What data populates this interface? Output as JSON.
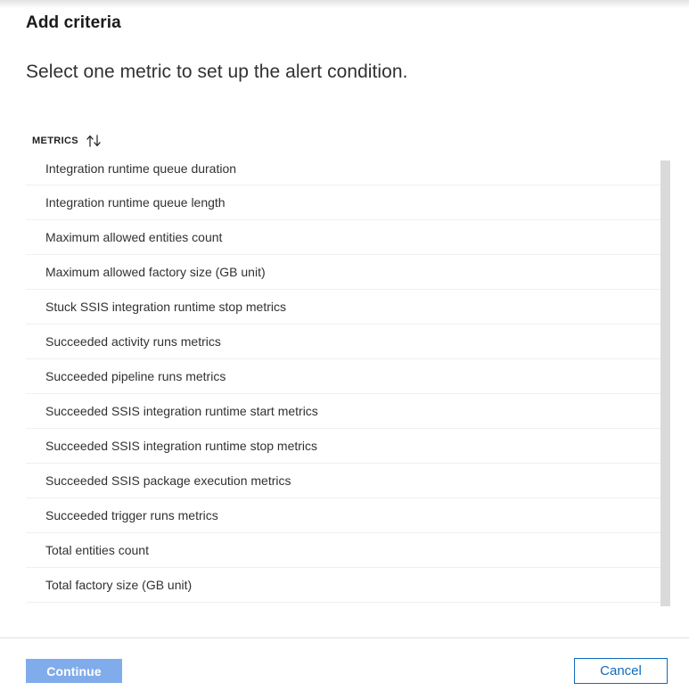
{
  "blade": {
    "title": "Add criteria",
    "subtitle": "Select one metric to set up the alert condition."
  },
  "list": {
    "column_header": "METRICS",
    "sort_icon": "sort-up-down-icon",
    "rows": [
      {
        "label": "Integration runtime queue duration"
      },
      {
        "label": "Integration runtime queue length"
      },
      {
        "label": "Maximum allowed entities count"
      },
      {
        "label": "Maximum allowed factory size (GB unit)"
      },
      {
        "label": "Stuck SSIS integration runtime stop metrics"
      },
      {
        "label": "Succeeded activity runs metrics"
      },
      {
        "label": "Succeeded pipeline runs metrics"
      },
      {
        "label": "Succeeded SSIS integration runtime start metrics"
      },
      {
        "label": "Succeeded SSIS integration runtime stop metrics"
      },
      {
        "label": "Succeeded SSIS package execution metrics"
      },
      {
        "label": "Succeeded trigger runs metrics"
      },
      {
        "label": "Total entities count"
      },
      {
        "label": "Total factory size (GB unit)"
      }
    ]
  },
  "footer": {
    "continue_label": "Continue",
    "cancel_label": "Cancel"
  },
  "colors": {
    "accent_blue": "#0f6cbd",
    "continue_disabled_blue": "#81aceb",
    "row_divider": "#f0f0f0",
    "scrollbar_thumb": "#dadada",
    "footer_divider": "#e1dfdd",
    "text_primary": "#323130"
  }
}
